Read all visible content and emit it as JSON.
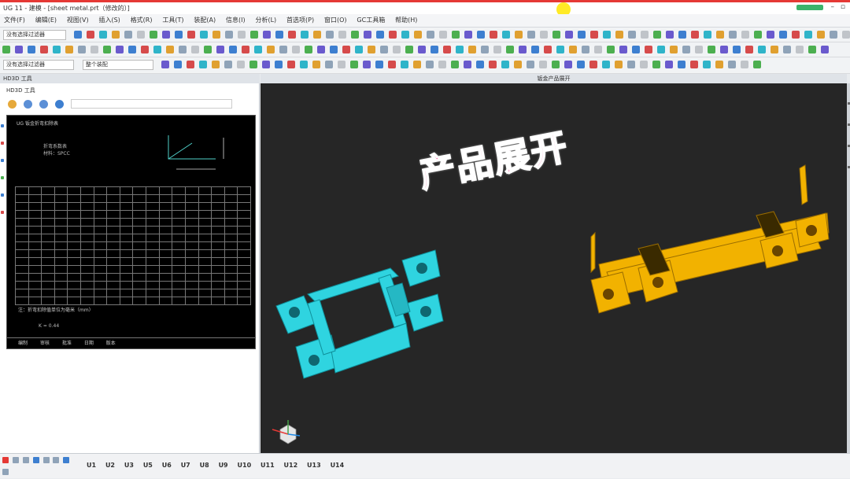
{
  "window": {
    "title": "UG 11 - 建模 - [sheet metal.prt（修改的）]"
  },
  "menu": {
    "items": [
      "文件(F)",
      "编辑(E)",
      "视图(V)",
      "插入(S)",
      "格式(R)",
      "工具(T)",
      "装配(A)",
      "信息(I)",
      "分析(L)",
      "首选项(P)",
      "窗口(O)",
      "GC工具箱",
      "帮助(H)"
    ]
  },
  "toolbar": {
    "filter_value": "没有选择过滤器",
    "assembly_value": "整个装配"
  },
  "left_panel": {
    "title": "HD3D 工具",
    "doc_header": "UG 钣金折弯扣除表",
    "doc_sub1": "折弯系数表",
    "doc_sub2": "材料：SPCC",
    "note": "注：折弯扣除值单位为毫米（mm）",
    "note2": "K = 0.44",
    "footer": [
      "编制",
      "审核",
      "批准",
      "日期",
      "版本"
    ]
  },
  "viewport": {
    "title": "钣金产品展开",
    "overlay_text": "产品展开",
    "folded_color": "#2fd4e0",
    "flat_color": "#f2b200",
    "background": "#262626"
  },
  "statusbar": {
    "items": [
      "U1",
      "U2",
      "U3",
      "U5",
      "U6",
      "U7",
      "U8",
      "U9",
      "U10",
      "U11",
      "U12",
      "U13",
      "U14"
    ]
  }
}
